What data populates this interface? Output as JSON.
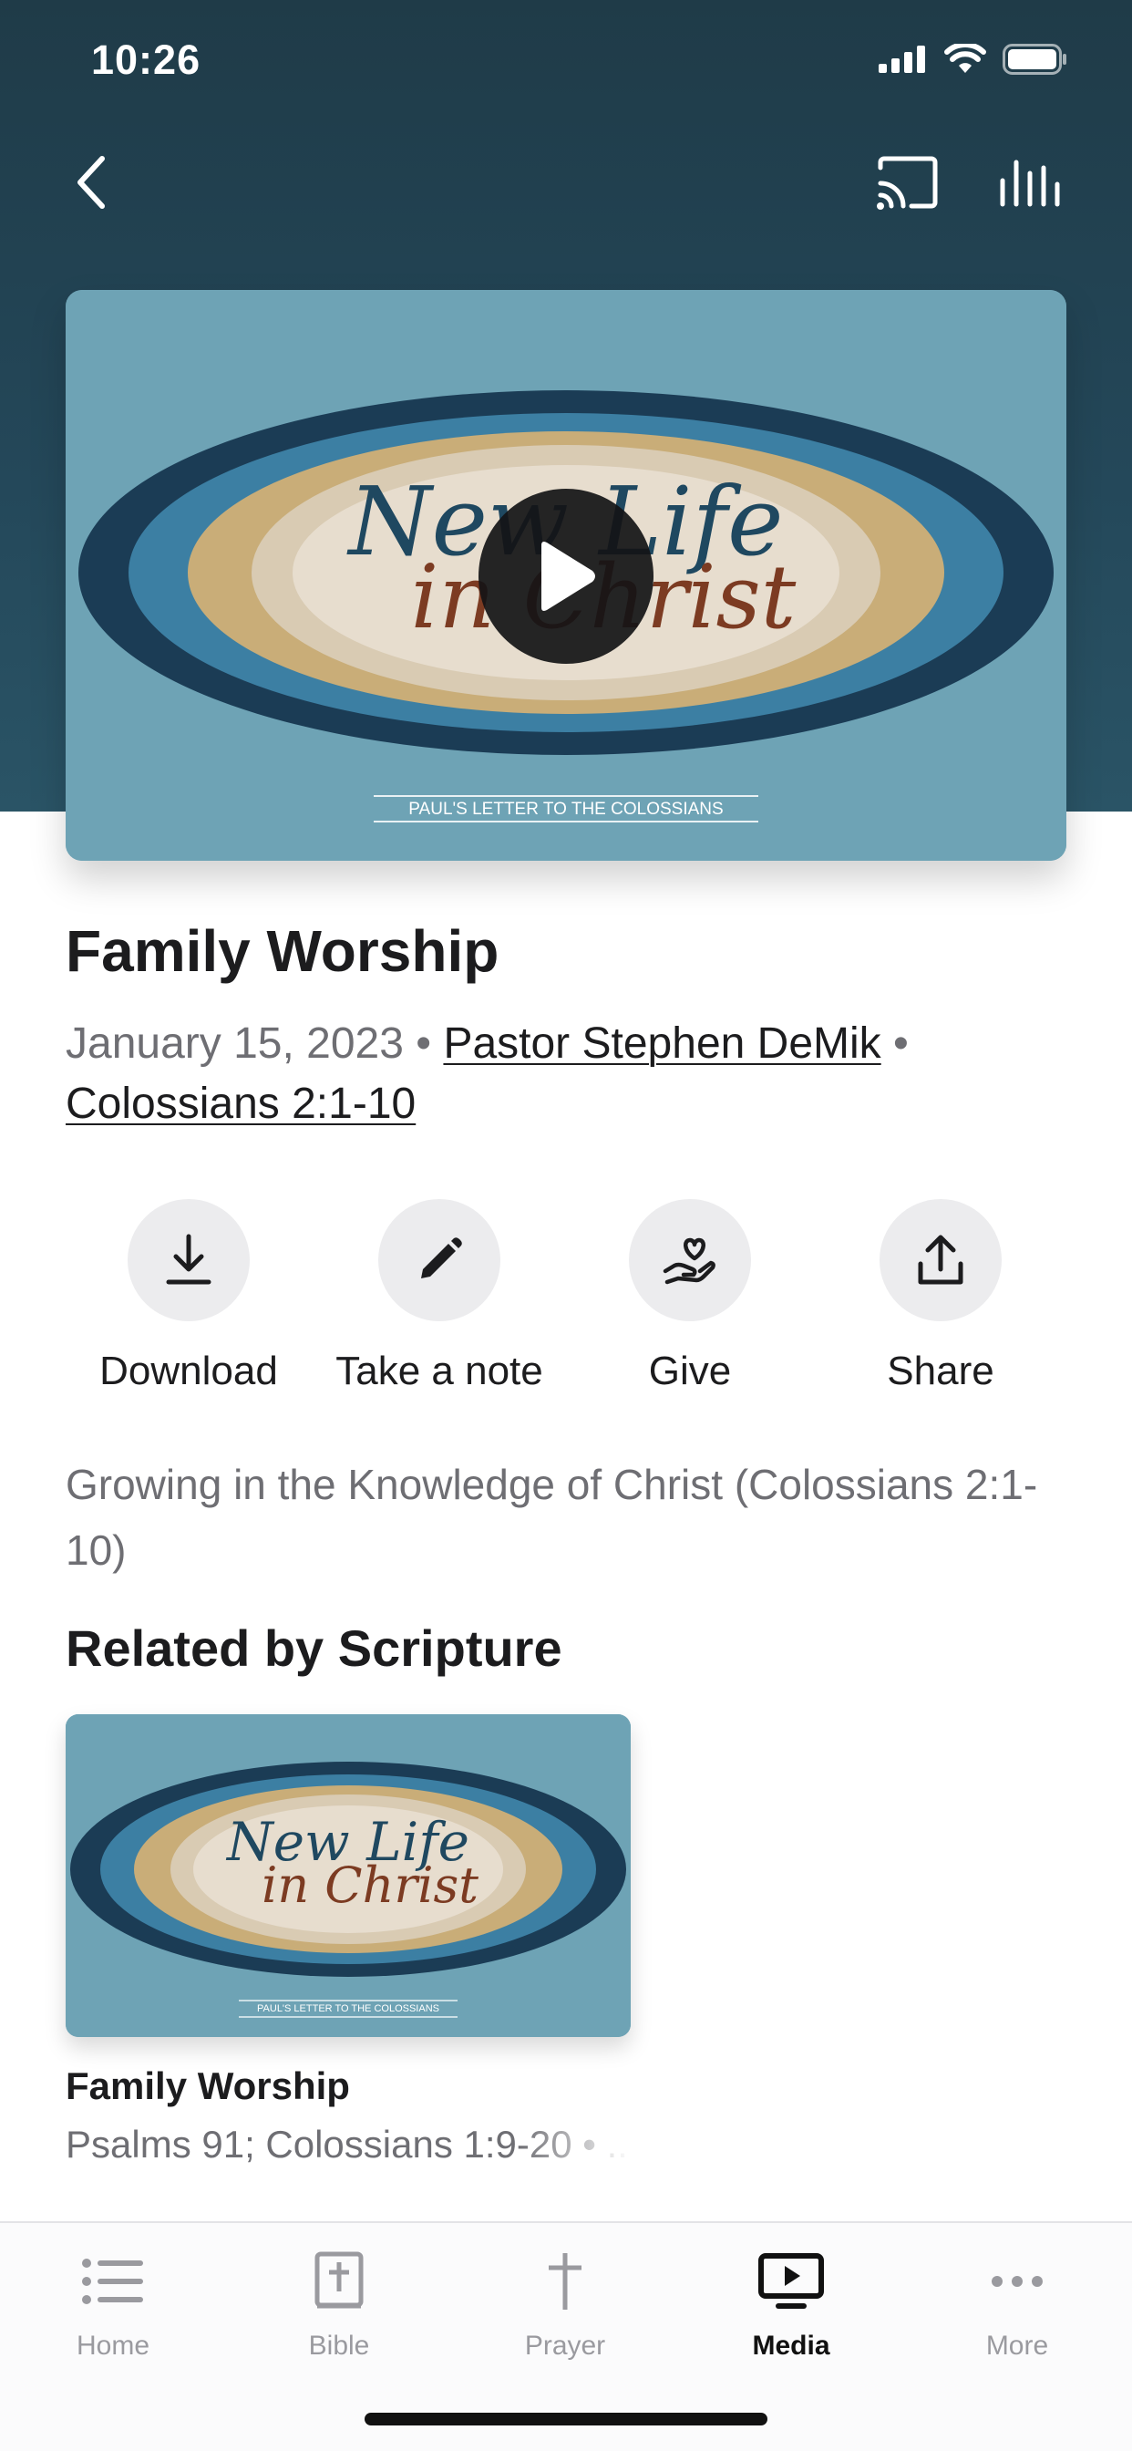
{
  "status_bar": {
    "time": "10:26"
  },
  "video": {
    "artwork_title_line1": "New Life",
    "artwork_title_line2": "in Christ",
    "artwork_subtitle": "PAUL'S LETTER TO THE COLOSSIANS"
  },
  "sermon": {
    "title": "Family Worship",
    "date": "January 15, 2023",
    "separator": " • ",
    "speaker": "Pastor Stephen DeMik",
    "scripture": "Colossians 2:1-10",
    "description": "Growing in the Knowledge of Christ (Colossians 2:1-10)"
  },
  "actions": [
    {
      "label": "Download",
      "icon": "download-icon"
    },
    {
      "label": "Take a note",
      "icon": "pencil-icon"
    },
    {
      "label": "Give",
      "icon": "heart-hand-icon"
    },
    {
      "label": "Share",
      "icon": "share-icon"
    }
  ],
  "related": {
    "section_title": "Related by Scripture",
    "items": [
      {
        "title": "Family Worship",
        "subtitle": "Psalms 91; Colossians 1:9-20 • ..."
      }
    ]
  },
  "tabs": [
    {
      "label": "Home",
      "icon": "list-icon",
      "active": false
    },
    {
      "label": "Bible",
      "icon": "bible-icon",
      "active": false
    },
    {
      "label": "Prayer",
      "icon": "cross-icon",
      "active": false
    },
    {
      "label": "Media",
      "icon": "media-icon",
      "active": true
    },
    {
      "label": "More",
      "icon": "more-icon",
      "active": false
    }
  ],
  "colors": {
    "header_bg": "#24485a",
    "artwork_bg": "#6ea3b5",
    "text_primary": "#1c1c1e",
    "text_secondary": "#6e6e73"
  }
}
